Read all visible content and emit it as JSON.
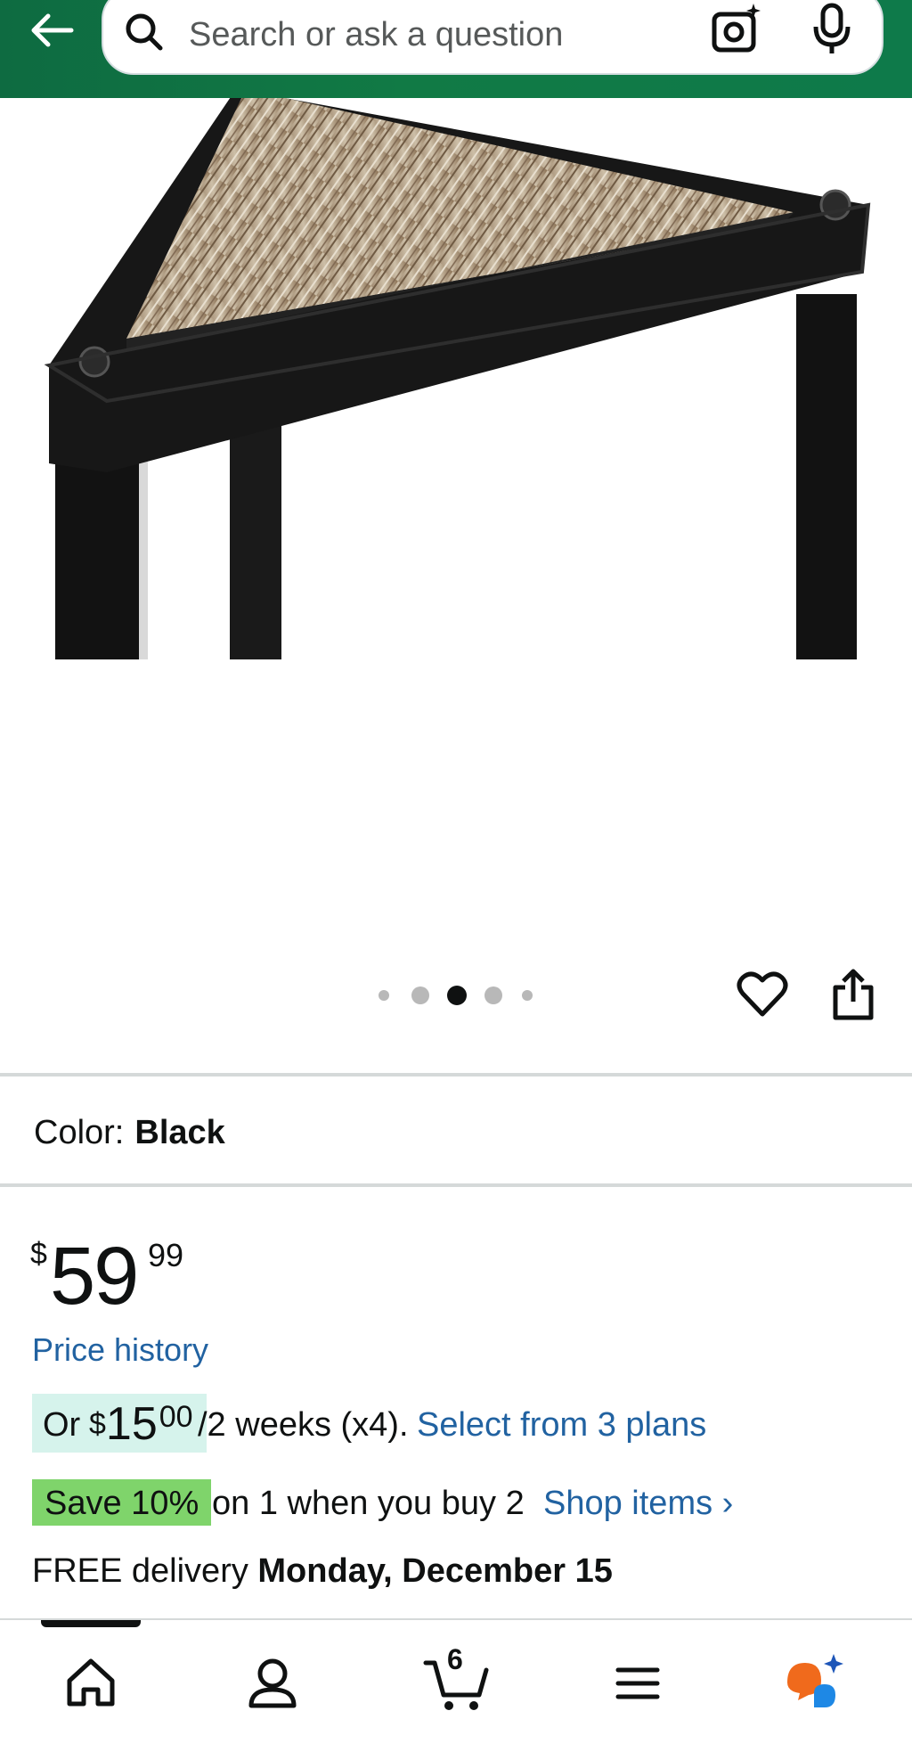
{
  "header": {
    "search_placeholder": "Search or ask a question",
    "colors": {
      "bar": "#117a45",
      "icon": "#0f1111"
    }
  },
  "carousel": {
    "image_description_icon": "product-image",
    "dot_count": 5,
    "active_dot_index": 2
  },
  "product": {
    "color_label": "Color:",
    "color_value": "Black",
    "price_symbol": "$",
    "price_whole": "59",
    "price_fraction": "99",
    "price_history_link": "Price history",
    "plan_or": "Or",
    "plan_symbol": "$",
    "plan_whole": "15",
    "plan_fraction": "00",
    "plan_terms": "/2 weeks (x4).",
    "plan_link": "Select from 3 plans",
    "save_badge": "Save 10%",
    "save_terms": "on 1 when you buy 2",
    "save_link": "Shop items ›",
    "delivery_prefix": "FREE delivery",
    "delivery_date": "Monday, December 15"
  },
  "bottom_nav": {
    "items": [
      "home-icon",
      "account-icon",
      "cart-icon",
      "menu-icon",
      "rufus-icon"
    ],
    "cart_count": "6"
  }
}
